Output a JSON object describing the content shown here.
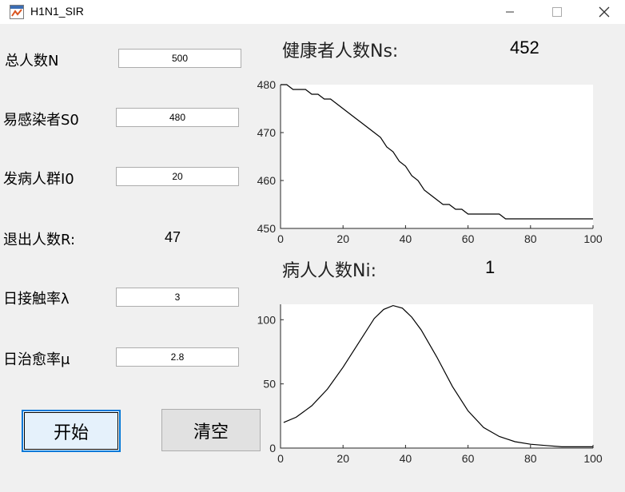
{
  "window": {
    "title": "H1N1_SIR"
  },
  "inputs": {
    "total_label": "总人数N",
    "total_value": "500",
    "s0_label": "易感染者S0",
    "s0_value": "480",
    "i0_label": "发病人群I0",
    "i0_value": "20",
    "lambda_label": "日接触率λ",
    "lambda_value": "3",
    "mu_label": "日治愈率μ",
    "mu_value": "2.8"
  },
  "removed": {
    "label": "退出人数R:",
    "value": "47"
  },
  "healthy": {
    "label": "健康者人数Ns:",
    "value": "452"
  },
  "sick": {
    "label": "病人人数Ni:",
    "value": "1"
  },
  "buttons": {
    "start": "开始",
    "clear": "清空"
  },
  "chart_data": [
    {
      "type": "line",
      "xlim": [
        0,
        100
      ],
      "ylim": [
        450,
        480
      ],
      "xticks": [
        0,
        20,
        40,
        60,
        80,
        100
      ],
      "yticks": [
        450,
        460,
        470,
        480
      ],
      "x": [
        0,
        2,
        4,
        6,
        8,
        10,
        12,
        14,
        16,
        18,
        20,
        22,
        24,
        26,
        28,
        30,
        32,
        34,
        36,
        38,
        40,
        42,
        44,
        46,
        48,
        50,
        52,
        54,
        56,
        58,
        60,
        62,
        64,
        66,
        68,
        70,
        72,
        74,
        76,
        78,
        80,
        85,
        90,
        95,
        100
      ],
      "y": [
        480,
        480,
        479,
        479,
        479,
        478,
        478,
        477,
        477,
        476,
        475,
        474,
        473,
        472,
        471,
        470,
        469,
        467,
        466,
        464,
        463,
        461,
        460,
        458,
        457,
        456,
        455,
        455,
        454,
        454,
        453,
        453,
        453,
        453,
        453,
        453,
        452,
        452,
        452,
        452,
        452,
        452,
        452,
        452,
        452
      ],
      "series": [
        {
          "color": "#000000"
        }
      ]
    },
    {
      "type": "line",
      "xlim": [
        0,
        100
      ],
      "ylim": [
        0,
        112
      ],
      "xticks": [
        0,
        20,
        40,
        60,
        80,
        100
      ],
      "yticks": [
        0,
        50,
        100
      ],
      "x": [
        1,
        5,
        10,
        15,
        20,
        25,
        30,
        33,
        36,
        39,
        42,
        45,
        50,
        55,
        60,
        65,
        70,
        75,
        80,
        85,
        90,
        95,
        100
      ],
      "y": [
        20,
        24,
        33,
        46,
        63,
        82,
        101,
        108,
        111,
        109,
        102,
        92,
        71,
        48,
        29,
        16,
        9,
        5,
        3,
        2,
        1,
        1,
        1
      ],
      "series": [
        {
          "color": "#000000"
        }
      ]
    }
  ]
}
